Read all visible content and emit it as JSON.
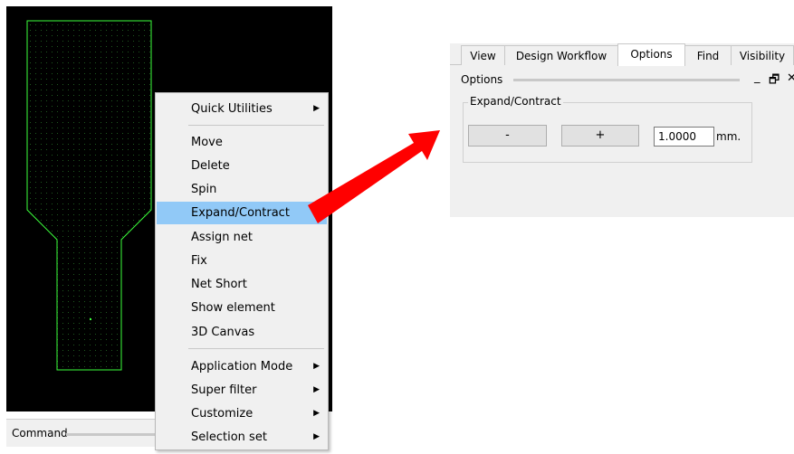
{
  "command_bar": {
    "label": "Command"
  },
  "context_menu": {
    "items": [
      {
        "label": "Quick Utilities",
        "has_submenu": true
      },
      {
        "label": "Move",
        "has_submenu": false
      },
      {
        "label": "Delete",
        "has_submenu": false
      },
      {
        "label": "Spin",
        "has_submenu": false
      },
      {
        "label": "Expand/Contract",
        "has_submenu": false,
        "highlighted": true
      },
      {
        "label": "Assign net",
        "has_submenu": false
      },
      {
        "label": "Fix",
        "has_submenu": false
      },
      {
        "label": "Net Short",
        "has_submenu": false
      },
      {
        "label": "Show element",
        "has_submenu": false
      },
      {
        "label": "3D Canvas",
        "has_submenu": false
      },
      {
        "label": "Application Mode",
        "has_submenu": true
      },
      {
        "label": "Super filter",
        "has_submenu": true
      },
      {
        "label": "Customize",
        "has_submenu": true
      },
      {
        "label": "Selection set",
        "has_submenu": true
      }
    ],
    "submenu_arrow": "▶"
  },
  "options_panel": {
    "tabs": [
      {
        "label": "View"
      },
      {
        "label": "Design Workflow"
      },
      {
        "label": "Options",
        "active": true
      },
      {
        "label": "Find"
      },
      {
        "label": "Visibility"
      }
    ],
    "title": "Options",
    "window_controls": {
      "minimize": "_",
      "restore": "🗗",
      "close": "✕"
    },
    "group_label": "Expand/Contract",
    "minus_label": "-",
    "plus_label": "+",
    "value": "1.0000",
    "unit": "mm."
  },
  "colors": {
    "canvas_bg": "#000000",
    "shape_outline": "#3cff3c",
    "menu_highlight": "#91c9f7",
    "arrow": "#ff0000"
  },
  "icons": [
    "chevron-right-icon",
    "minimize-icon",
    "restore-icon",
    "close-icon",
    "red-arrow-icon"
  ]
}
